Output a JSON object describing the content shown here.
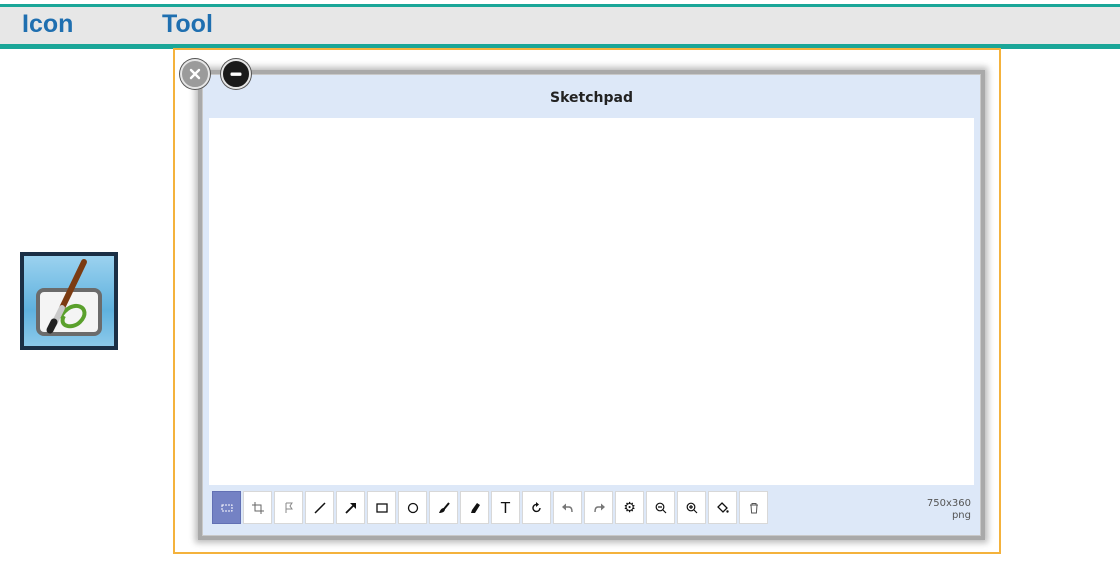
{
  "header": {
    "icon_col": "Icon",
    "tool_col": "Tool"
  },
  "app_icon": {
    "name": "sketchpad-app-icon"
  },
  "window": {
    "title": "Sketchpad",
    "dimensions": "750x360",
    "format": "png",
    "controls": [
      "close-icon",
      "minimize-icon"
    ]
  },
  "toolbar": [
    {
      "name": "select-tool",
      "icon": "marquee-icon",
      "active": true
    },
    {
      "name": "crop-tool",
      "icon": "crop-icon"
    },
    {
      "name": "flag-tool",
      "icon": "flag-icon"
    },
    {
      "name": "line-tool",
      "icon": "line-icon"
    },
    {
      "name": "arrow-tool",
      "icon": "arrow-icon"
    },
    {
      "name": "rectangle-tool",
      "icon": "rectangle-icon"
    },
    {
      "name": "ellipse-tool",
      "icon": "circle-icon"
    },
    {
      "name": "brush-tool",
      "icon": "brush-icon"
    },
    {
      "name": "eraser-tool",
      "icon": "eraser-icon"
    },
    {
      "name": "text-tool",
      "icon": "text-icon"
    },
    {
      "name": "rotate-tool",
      "icon": "rotate-icon"
    },
    {
      "name": "undo-tool",
      "icon": "undo-icon"
    },
    {
      "name": "redo-tool",
      "icon": "redo-icon"
    },
    {
      "name": "settings-tool",
      "icon": "gear-icon"
    },
    {
      "name": "zoom-out-tool",
      "icon": "zoom-out-icon"
    },
    {
      "name": "zoom-in-tool",
      "icon": "zoom-in-icon"
    },
    {
      "name": "fill-tool",
      "icon": "paint-bucket-icon"
    },
    {
      "name": "delete-tool",
      "icon": "trash-icon"
    }
  ]
}
